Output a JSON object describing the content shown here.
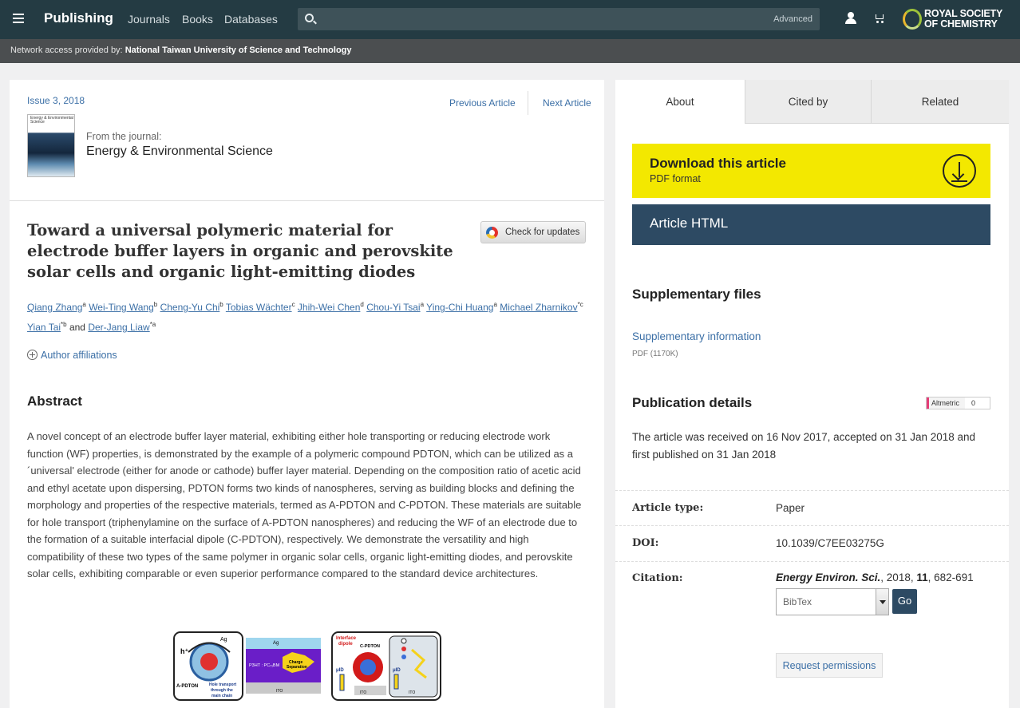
{
  "header": {
    "brand": "Publishing",
    "nav": [
      "Journals",
      "Books",
      "Databases"
    ],
    "search_placeholder": "",
    "advanced_label": "Advanced",
    "logo_text_line1": "ROYAL SOCIETY",
    "logo_text_line2": "OF CHEMISTRY",
    "icons": [
      "menu-icon",
      "search-icon",
      "user-icon",
      "cart-icon"
    ]
  },
  "access": {
    "label": "Network access provided by:",
    "institution": "National Taiwan University of Science and Technology"
  },
  "article": {
    "issue": "Issue 3, 2018",
    "prev_label": "Previous Article",
    "next_label": "Next Article",
    "from_journal_label": "From the journal:",
    "journal_name": "Energy & Environmental Science",
    "cover_text": "Energy & Environmental Science",
    "title": "Toward a universal polymeric material for electrode buffer layers in organic and perovskite solar cells and organic light-emitting diodes",
    "check_updates_label": "Check for updates",
    "authors": [
      {
        "name": "Qiang Zhang",
        "sup": "a"
      },
      {
        "name": "Wei-Ting Wang",
        "sup": "b"
      },
      {
        "name": "Cheng-Yu Chi",
        "sup": "b"
      },
      {
        "name": "Tobias Wächter",
        "sup": "c"
      },
      {
        "name": "Jhih-Wei Chen",
        "sup": "d"
      },
      {
        "name": "Chou-Yi Tsai",
        "sup": "a"
      },
      {
        "name": "Ying-Chi Huang",
        "sup": "a"
      },
      {
        "name": "Michael Zharnikov",
        "sup": "*c"
      },
      {
        "name": "Yian Tai",
        "sup": "*b"
      },
      {
        "name": "Der-Jang Liaw",
        "sup": "*a"
      }
    ],
    "and_word": "and",
    "affiliations_label": "Author affiliations",
    "abstract_heading": "Abstract",
    "abstract_text": "A novel concept of an electrode buffer layer material, exhibiting either hole transporting or reducing electrode work function (WF) properties, is demonstrated by the example of a polymeric compound PDTON, which can be utilized as a ´universal' electrode (either for anode or cathode) buffer layer material. Depending on the composition ratio of acetic acid and ethyl acetate upon dispersing, PDTON forms two kinds of nanospheres, serving as building blocks and defining the morphology and properties of the respective materials, termed as A-PDTON and C-PDTON. These materials are suitable for hole transport (triphenylamine on the surface of A-PDTON nanospheres) and reducing the WF of an electrode due to the formation of a suitable interfacial dipole (C-PDTON), respectively. We demonstrate the versatility and high compatibility of these two types of the same polymer in organic solar cells, organic light-emitting diodes, and perovskite solar cells, exhibiting comparable or even superior performance compared to the standard device architectures.",
    "toc_labels": {
      "hplus": "h⁺",
      "ag1": "Ag",
      "ag2": "Ag",
      "apdton": "A-PDTON",
      "hole_transport": "Hole transport",
      "through_the": "through the",
      "main_chain": "main chain",
      "p3ht": "P3HT : PC₇₁BM",
      "charge": "Charge",
      "separation": "Separation",
      "ito1": "ITO",
      "ito2": "ITO",
      "ito3": "ITO",
      "interface": "Interface",
      "dipole": "dipole",
      "cpdton": "C-PDTON",
      "mu1": "μID",
      "mu2": "μID"
    }
  },
  "sidebar": {
    "tabs": [
      "About",
      "Cited by",
      "Related"
    ],
    "download_heading": "Download this article",
    "download_sub": "PDF format",
    "html_label": "Article HTML",
    "supp_heading": "Supplementary files",
    "supp_link": "Supplementary information",
    "supp_size": "PDF (1170K)",
    "pub_heading": "Publication details",
    "altmetric_label": "Altmetric",
    "altmetric_count": "0",
    "pub_text": "The article was received on 16 Nov 2017, accepted on 31 Jan 2018 and first published on 31 Jan 2018",
    "article_type_label": "Article type:",
    "article_type": "Paper",
    "doi_label": "DOI:",
    "doi": "10.1039/C7EE03275G",
    "citation_label": "Citation:",
    "citation_journal": "Energy Environ. Sci.",
    "citation_year": ", 2018, ",
    "citation_volume": "11",
    "citation_pages": ", 682-691",
    "format_selected": "BibTex",
    "go_label": "Go",
    "permissions_label": "Request permissions"
  },
  "colors": {
    "topbar": "#243b43",
    "link": "#3b6fa6",
    "download_bg": "#f3e800",
    "html_btn_bg": "#2d4a63"
  }
}
